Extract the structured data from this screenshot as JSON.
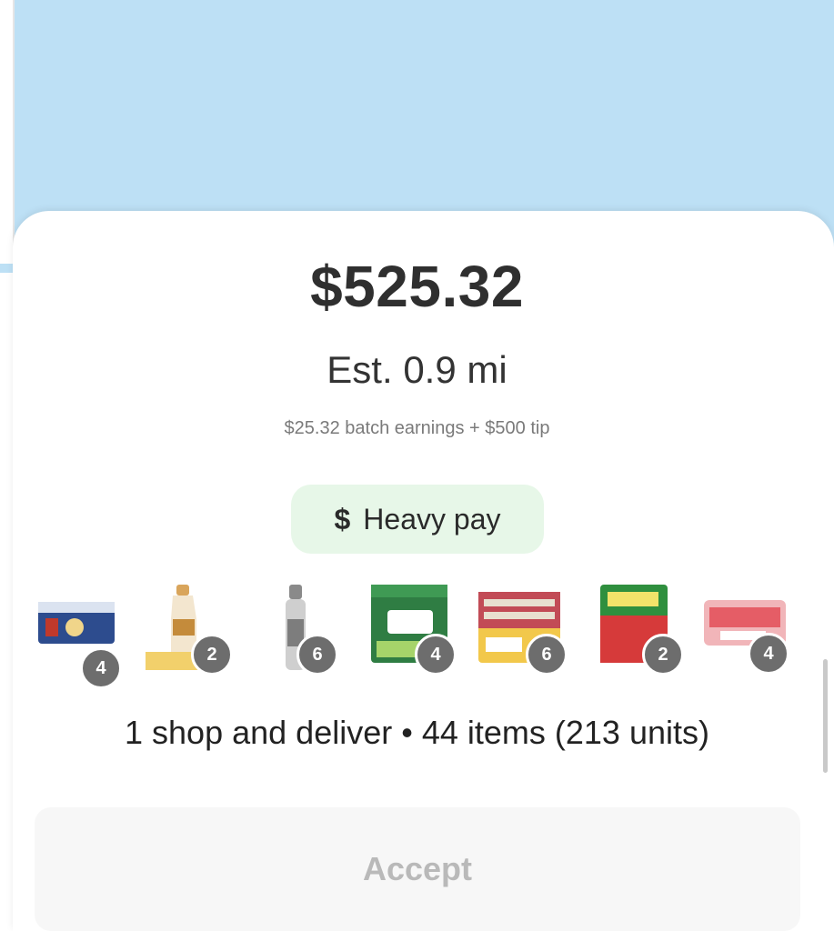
{
  "offer": {
    "total": "$525.32",
    "distance": "Est. 0.9 mi",
    "breakdown": "$25.32 batch earnings + $500 tip",
    "badge": {
      "symbol": "$",
      "label": "Heavy pay",
      "color": "#e7f7e8"
    }
  },
  "items": [
    {
      "icon": "drink-pack-icon",
      "qty": "4"
    },
    {
      "icon": "creamer-bottle-icon",
      "qty": "2"
    },
    {
      "icon": "spray-bottle-icon",
      "qty": "6"
    },
    {
      "icon": "coffee-pods-box-icon",
      "qty": "4"
    },
    {
      "icon": "snack-bars-box-icon",
      "qty": "6"
    },
    {
      "icon": "juice-box-pack-icon",
      "qty": "2"
    },
    {
      "icon": "soda-pack-icon",
      "qty": "4"
    }
  ],
  "summary": "1 shop and deliver • 44 items (213 units)",
  "accept_label": "Accept",
  "colors": {
    "map": "#bde0f5",
    "badge_bg": "#e7f7e8",
    "qty_badge": "#6d6d6d"
  }
}
